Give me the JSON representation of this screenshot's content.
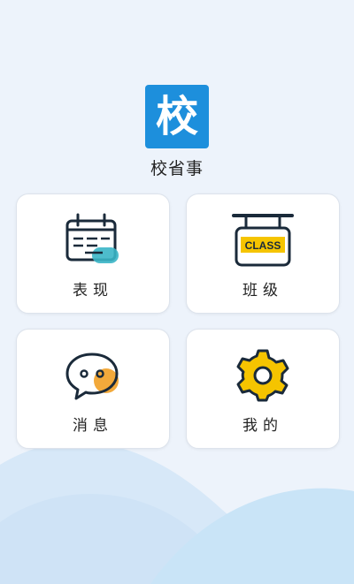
{
  "app": {
    "logo_char": "校",
    "name": "校省事"
  },
  "cards": [
    {
      "label": "表现",
      "icon": "calendar-icon"
    },
    {
      "label": "班级",
      "icon": "class-sign-icon",
      "sign_text": "CLASS"
    },
    {
      "label": "消息",
      "icon": "chat-bubble-icon"
    },
    {
      "label": "我的",
      "icon": "gear-icon"
    }
  ],
  "colors": {
    "brand": "#1d8fdc",
    "accent_teal": "#3ab5c6",
    "accent_yellow": "#f5c400",
    "accent_orange": "#f2a93b",
    "outline": "#1a2a3a"
  }
}
